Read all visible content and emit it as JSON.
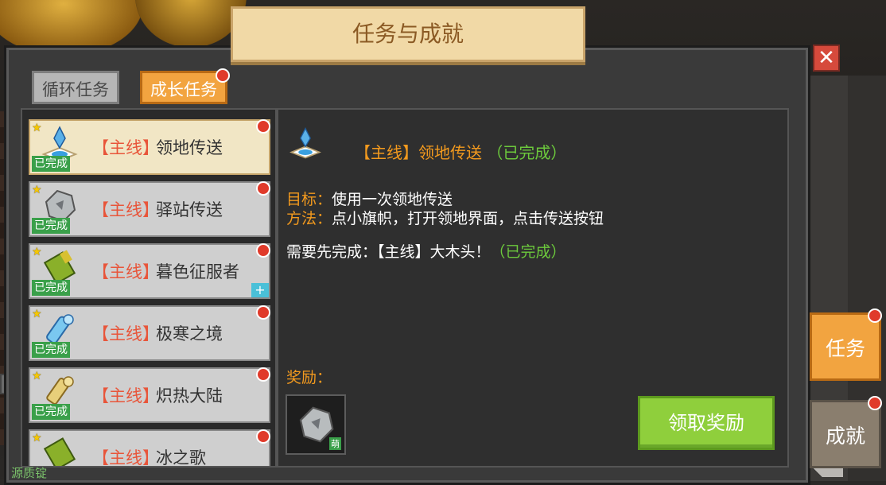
{
  "window": {
    "title": "任务与成就",
    "close_label": "✕"
  },
  "tabs": [
    {
      "label": "循环任务",
      "active": false
    },
    {
      "label": "成长任务",
      "active": true,
      "has_notification": true
    }
  ],
  "quests": [
    {
      "tag": "【主线】",
      "name": "领地传送",
      "status": "已完成",
      "selected": true,
      "icon": "teleport-portal-icon"
    },
    {
      "tag": "【主线】",
      "name": "驿站传送",
      "status": "已完成",
      "selected": false,
      "icon": "stone-ore-icon"
    },
    {
      "tag": "【主线】",
      "name": "暮色征服者",
      "status": "已完成",
      "selected": false,
      "icon": "green-scroll-icon",
      "extra": "+"
    },
    {
      "tag": "【主线】",
      "name": "极寒之境",
      "status": "已完成",
      "selected": false,
      "icon": "ice-crystal-icon"
    },
    {
      "tag": "【主线】",
      "name": "炽热大陆",
      "status": "已完成",
      "selected": false,
      "icon": "gold-scroll-icon"
    },
    {
      "tag": "【主线】",
      "name": "冰之歌",
      "status": "",
      "selected": false,
      "icon": "green-scroll-icon"
    }
  ],
  "detail": {
    "title_tag": "【主线】",
    "title_name": "领地传送",
    "title_status": "（已完成）",
    "goal_key": "目标：",
    "goal_text": "使用一次领地传送",
    "method_key": "方法：",
    "method_text": "点小旗帜，打开领地界面，点击传送按钮",
    "prereq_text": "需要先完成：【主线】大木头！",
    "prereq_status": "（已完成）",
    "reward_label": "奖励：",
    "reward_badge": "萌",
    "claim_label": "领取奖励"
  },
  "side_buttons": {
    "task_label": "任务",
    "achievement_label": "成就"
  },
  "bottom_text": "源质锭",
  "colors": {
    "accent_orange": "#f39a1e",
    "complete_green": "#6cc93c",
    "tag_red": "#e8553a"
  }
}
